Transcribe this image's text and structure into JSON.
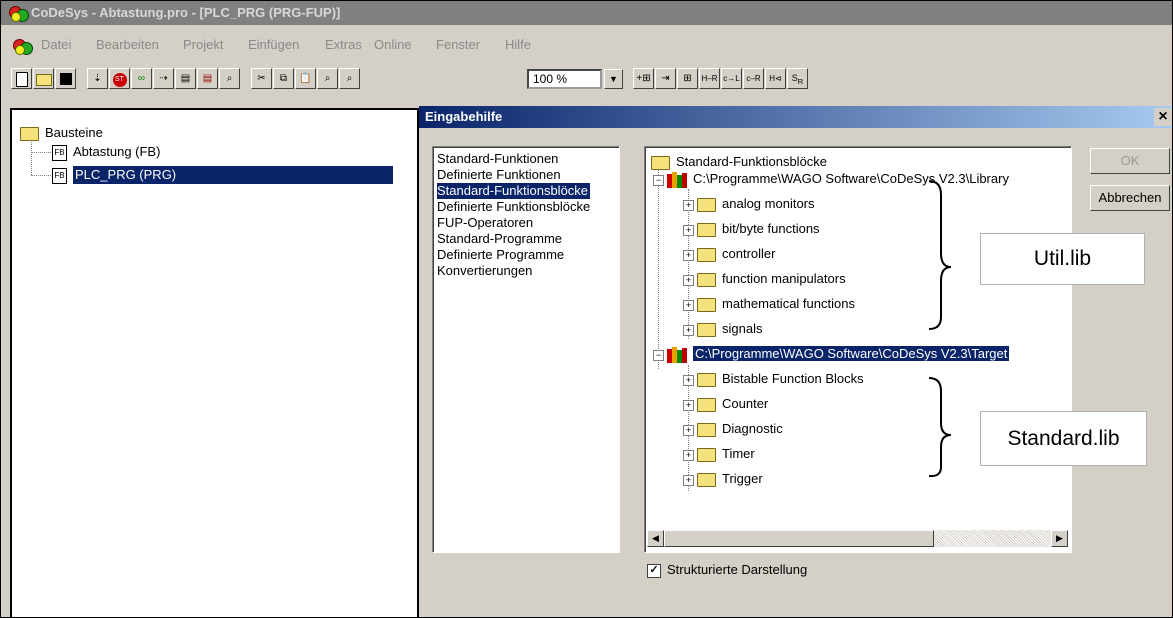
{
  "window": {
    "title": "CoDeSys - Abtastung.pro - [PLC_PRG (PRG-FUP)]"
  },
  "menu": [
    "Datei",
    "Bearbeiten",
    "Projekt",
    "Einfügen",
    "Extras",
    "Online",
    "Fenster",
    "Hilfe"
  ],
  "toolbar": {
    "zoom": "100 %",
    "icons": [
      "new-file-icon",
      "open-folder-icon",
      "save-icon",
      "download-icon",
      "stop-icon",
      "run-icon",
      "step-icon",
      "print-icon",
      "print-preview-icon",
      "find-icon",
      "cut-icon",
      "copy-icon",
      "paste-icon",
      "find-next-icon",
      "replace-icon",
      "insert-box-icon",
      "insert-input-icon",
      "insert-element-icon",
      "contact-icon",
      "coil-icon",
      "negation-icon",
      "jump-icon",
      "set-reset-icon"
    ]
  },
  "pou_tree": {
    "root": "Bausteine",
    "items": [
      {
        "label": "Abtastung (FB)",
        "selected": false
      },
      {
        "label": "PLC_PRG (PRG)",
        "selected": true
      }
    ]
  },
  "dialog": {
    "title": "Eingabehilfe",
    "close": "×",
    "categories": [
      {
        "label": "Standard-Funktionen",
        "selected": false
      },
      {
        "label": "Definierte Funktionen",
        "selected": false
      },
      {
        "label": "Standard-Funktionsblöcke",
        "selected": true
      },
      {
        "label": "Definierte Funktionsblöcke",
        "selected": false
      },
      {
        "label": "FUP-Operatoren",
        "selected": false
      },
      {
        "label": "Standard-Programme",
        "selected": false
      },
      {
        "label": "Definierte Programme",
        "selected": false
      },
      {
        "label": "Konvertierungen",
        "selected": false
      }
    ],
    "tree_root": "Standard-Funktionsblöcke",
    "libraries": [
      {
        "path": "C:\\Programme\\WAGO Software\\CoDeSys V2.3\\Library",
        "selected": false,
        "folders": [
          "analog monitors",
          "bit/byte functions",
          "controller",
          "function manipulators",
          "mathematical functions",
          "signals"
        ]
      },
      {
        "path": "C:\\Programme\\WAGO Software\\CoDeSys V2.3\\Target",
        "selected": true,
        "folders": [
          "Bistable Function Blocks",
          "Counter",
          "Diagnostic",
          "Timer",
          "Trigger"
        ]
      }
    ],
    "ok": "OK",
    "cancel": "Abbrechen",
    "checkbox_label": "Strukturierte Darstellung",
    "checkbox_checked": true
  },
  "annotations": {
    "util": "Util.lib",
    "standard": "Standard.lib"
  }
}
